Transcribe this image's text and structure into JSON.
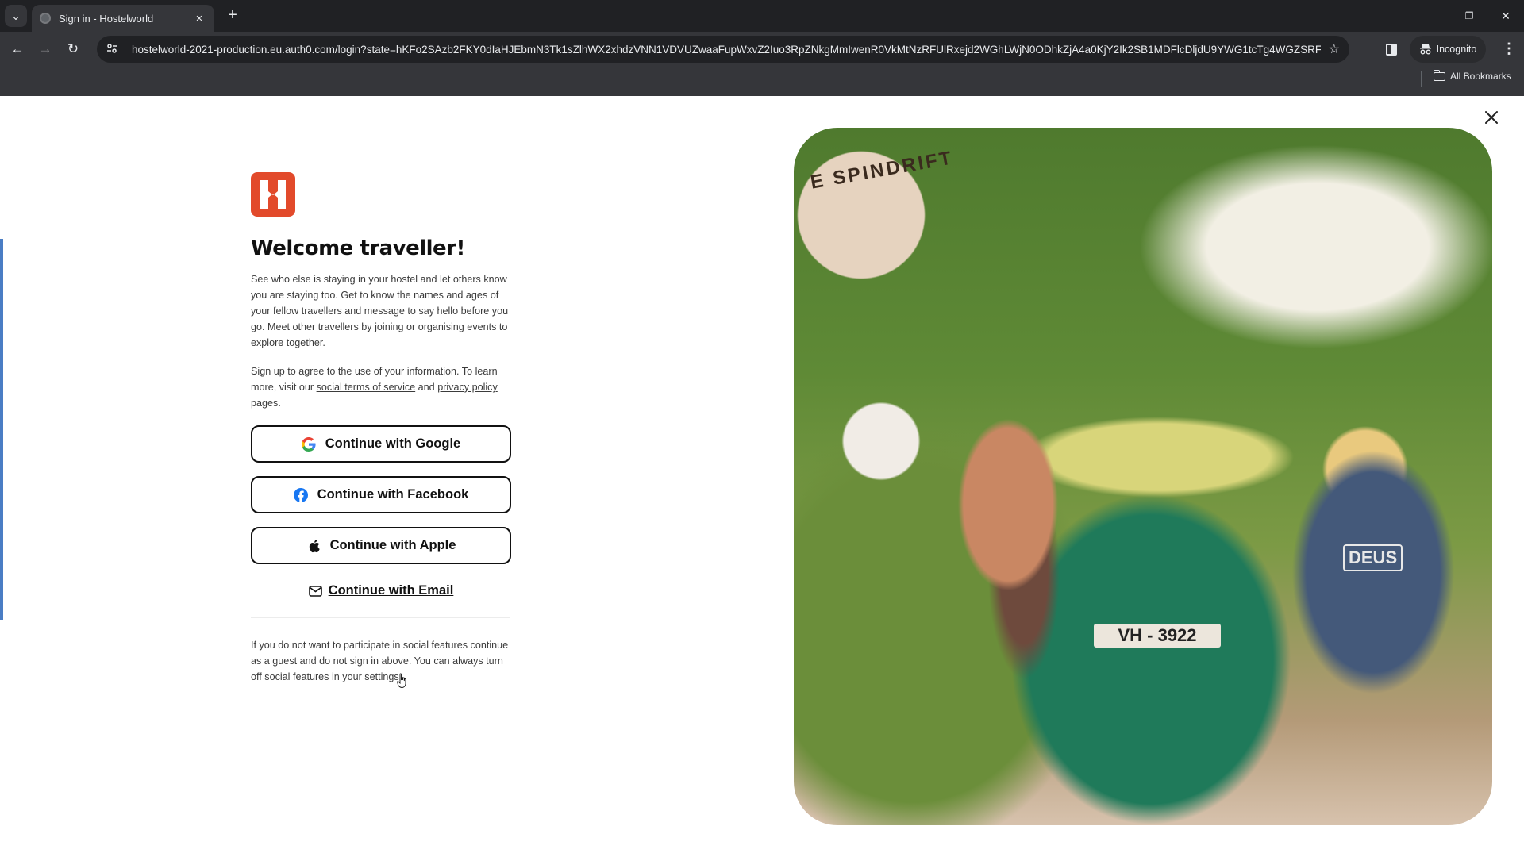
{
  "browser": {
    "tab": {
      "title": "Sign in - Hostelworld",
      "favicon": "globe-icon",
      "close_label": "×"
    },
    "new_tab_label": "+",
    "tab_search_label": "⌄",
    "window_controls": {
      "minimize": "–",
      "restore": "❐",
      "close": "✕"
    },
    "nav": {
      "back": "←",
      "forward": "→",
      "reload": "↻"
    },
    "address_bar": {
      "url": "hostelworld-2021-production.eu.auth0.com/login?state=hKFo2SAzb2FKY0dIaHJEbmN3Tk1sZlhWX2xhdzVNN1VDVUZwaaFupWxvZ2Iuo3RpZNkgMmIwenR0VkMtNzRFUlRxejd2WGhLWjN0ODhkZjA4a0KjY2Ik2SB1MDFlcDljdU9YWG1tcTg4WGZSRFZa...",
      "site_info_icon": "tune-icon",
      "bookmark_icon": "star-icon"
    },
    "profile": {
      "label": "Incognito",
      "icon": "incognito-icon"
    },
    "bookmarks_bar": {
      "all_bookmarks_label": "All Bookmarks"
    }
  },
  "login": {
    "brand": "Hostelworld",
    "brand_color": "#e24a2b",
    "headline": "Welcome traveller!",
    "intro": "See who else is staying in your hostel and let others know you are staying too. Get to know the names and ages of your fellow travellers and message to say hello before you go. Meet other travellers by joining or organising events to explore together.",
    "consent": {
      "before": "Sign up to agree to the use of your information. To learn more, visit our ",
      "terms_link": "social terms of service",
      "middle": " and ",
      "privacy_link": "privacy policy",
      "after": " pages."
    },
    "buttons": {
      "google": "Continue with Google",
      "facebook": "Continue with Facebook",
      "apple": "Continue with Apple",
      "email": "Continue with Email"
    },
    "footer_note": "If you do not want to participate in social features continue as a guest and do not sign in above. You can always turn off social features in your settings."
  },
  "hero": {
    "description": "Travellers posing around a green tuk-tuk with surfboards on the roof",
    "sign_text": "E SPINDRIFT",
    "plate_text": "VH - 3922",
    "shirt_text": "DEUS"
  },
  "modal": {
    "close_icon": "close-icon"
  }
}
